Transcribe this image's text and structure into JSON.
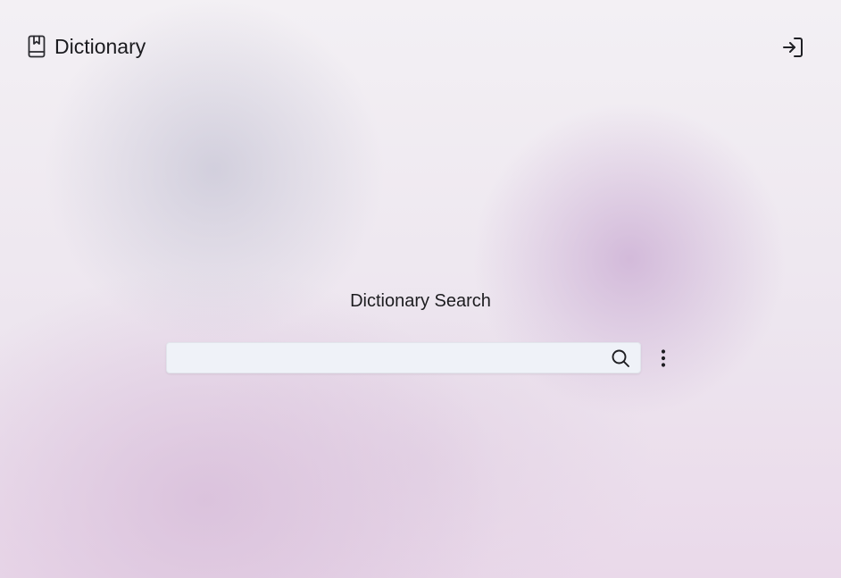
{
  "app": {
    "title": "Dictionary",
    "brand_icon": "book-bookmark-icon"
  },
  "header": {
    "login_icon": "log-in-icon"
  },
  "main": {
    "heading": "Dictionary Search",
    "search": {
      "value": "",
      "placeholder": "",
      "icon": "search-icon"
    },
    "more_icon": "more-vertical-icon"
  },
  "colors": {
    "search_bg": "#eff2f8",
    "text": "#1b1b1f",
    "accent_blob": "#ceb2d6"
  }
}
